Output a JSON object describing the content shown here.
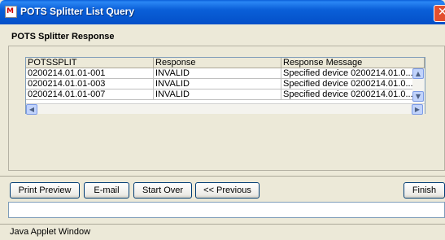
{
  "window": {
    "title": "POTS Splitter List Query",
    "close_glyph": "✕",
    "app_icon_glyph": "M"
  },
  "section": {
    "title": "POTS Splitter Response"
  },
  "table": {
    "columns": [
      "POTSSPLIT",
      "Response",
      "Response Message"
    ],
    "rows": [
      [
        "0200214.01.01-001",
        "INVALID",
        "Specified device 0200214.01.0..."
      ],
      [
        "0200214.01.01-003",
        "INVALID",
        "Specified device 0200214.01.0..."
      ],
      [
        "0200214.01.01-007",
        "INVALID",
        "Specified device 0200214.01.0..."
      ]
    ]
  },
  "buttons": {
    "print_preview": "Print Preview",
    "email": "E-mail",
    "start_over": "Start Over",
    "previous": "<< Previous",
    "finish": "Finish"
  },
  "status": {
    "value": ""
  },
  "applet_status": "Java Applet Window"
}
